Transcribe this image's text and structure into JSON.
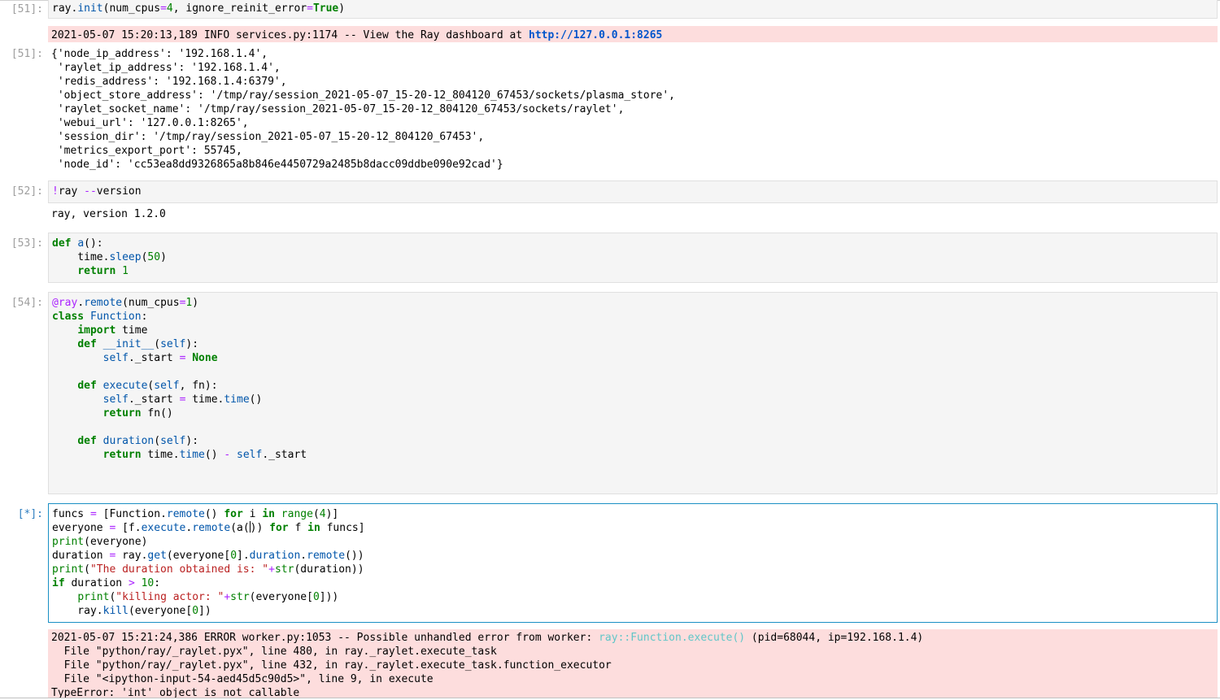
{
  "cells": [
    {
      "prompt": "[51]:",
      "code": "ray.init(num_cpus=4, ignore_reinit_error=True)"
    },
    {
      "prompt": "[52]:",
      "code": "!ray --version"
    },
    {
      "prompt": "[53]:",
      "code": "def a():\n    time.sleep(50)\n    return 1"
    },
    {
      "prompt": "[54]:",
      "code": "@ray.remote(num_cpus=1)\nclass Function:\n    import time\n    def __init__(self):\n        self._start = None\n\n    def execute(self, fn):\n        self._start = time.time()\n        return fn()\n\n    def duration(self):\n        return time.time() - self._start"
    },
    {
      "prompt": "[*]:",
      "code": "funcs = [Function.remote() for i in range(4)]\neveryone = [f.execute.remote(a()) for f in funcs]\nprint(everyone)\nduration = ray.get(everyone[0].duration.remote())\nprint(\"The duration obtained is: \"+str(duration))\nif duration > 10:\n    print(\"killing actor: \"+str(everyone[0]))\n    ray.kill(everyone[0])"
    }
  ],
  "outputs": {
    "c51_stderr_text": "2021-05-07 15:20:13,189 INFO services.py:1174 -- View the Ray dashboard at ",
    "c51_stderr_link": "http://127.0.0.1:8265",
    "c51_result_prompt": "[51]:",
    "c51_result": "{'node_ip_address': '192.168.1.4',\n 'raylet_ip_address': '192.168.1.4',\n 'redis_address': '192.168.1.4:6379',\n 'object_store_address': '/tmp/ray/session_2021-05-07_15-20-12_804120_67453/sockets/plasma_store',\n 'raylet_socket_name': '/tmp/ray/session_2021-05-07_15-20-12_804120_67453/sockets/raylet',\n 'webui_url': '127.0.0.1:8265',\n 'session_dir': '/tmp/ray/session_2021-05-07_15-20-12_804120_67453',\n 'metrics_export_port': 55745,\n 'node_id': 'cc53ea8dd9326865a8b846e4450729a2485b8dacc09ddbe090e92cad'}",
    "c52_stdout": "ray, version 1.2.0",
    "err_line1_pre": "2021-05-07 15:21:24,386 ERROR worker.py:1053 -- Possible unhandled error from worker: ",
    "err_line1_cyan": "ray::Function.execute()",
    "err_line1_post": " (pid=68044, ip=192.168.1.4)",
    "err_rest": "  File \"python/ray/_raylet.pyx\", line 480, in ray._raylet.execute_task\n  File \"python/ray/_raylet.pyx\", line 432, in ray._raylet.execute_task.function_executor\n  File \"<ipython-input-54-aed45d5c90d5>\", line 9, in execute\nTypeError: 'int' object is not callable"
  },
  "colors": {
    "stderr_bg": "#fddddd",
    "active_border": "#1a8fc4",
    "prompt": "#9e9e9e",
    "keyword": "#008000"
  }
}
